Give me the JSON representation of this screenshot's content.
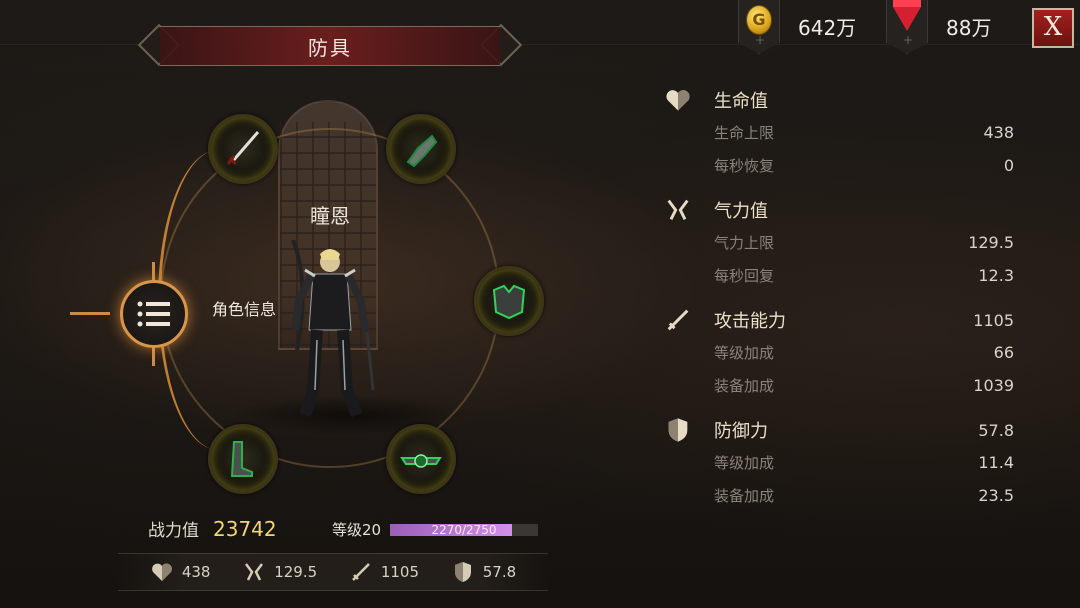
{
  "header": {
    "title": "防具",
    "gold_amount": "642万",
    "gem_amount": "88万",
    "close_label": "X",
    "coin_symbol": "G",
    "plus_symbol": "+"
  },
  "character": {
    "name": "瞳恩",
    "menu_label": "角色信息"
  },
  "equipment_slots": [
    {
      "slot": "weapon",
      "icon": "sword-icon"
    },
    {
      "slot": "gloves",
      "icon": "gauntlet-icon"
    },
    {
      "slot": "armor",
      "icon": "chest-armor-icon"
    },
    {
      "slot": "boots",
      "icon": "boots-icon"
    },
    {
      "slot": "belt",
      "icon": "belt-icon"
    }
  ],
  "power": {
    "label": "战力值",
    "value": "23742",
    "level_label": "等级20",
    "xp_text": "2270/2750",
    "xp_fraction": 0.825
  },
  "summary": {
    "health": "438",
    "stamina": "129.5",
    "attack": "1105",
    "defense": "57.8"
  },
  "stats": [
    {
      "icon": "heart-icon",
      "title": "生命值",
      "value": "",
      "rows": [
        {
          "label": "生命上限",
          "value": "438"
        },
        {
          "label": "每秒恢复",
          "value": "0"
        }
      ]
    },
    {
      "icon": "stamina-icon",
      "title": "气力值",
      "value": "",
      "rows": [
        {
          "label": "气力上限",
          "value": "129.5"
        },
        {
          "label": "每秒回复",
          "value": "12.3"
        }
      ]
    },
    {
      "icon": "sword-icon",
      "title": "攻击能力",
      "value": "1105",
      "rows": [
        {
          "label": "等级加成",
          "value": "66"
        },
        {
          "label": "装备加成",
          "value": "1039"
        }
      ]
    },
    {
      "icon": "shield-icon",
      "title": "防御力",
      "value": "57.8",
      "rows": [
        {
          "label": "等级加成",
          "value": "11.4"
        },
        {
          "label": "装备加成",
          "value": "23.5"
        }
      ]
    }
  ],
  "colors": {
    "accent_gold": "#f2d575",
    "xp_purple": "#d38ee8",
    "close_red": "#a3201e",
    "ring_orange": "#d9964a",
    "slot_glow": "#c8be28"
  }
}
